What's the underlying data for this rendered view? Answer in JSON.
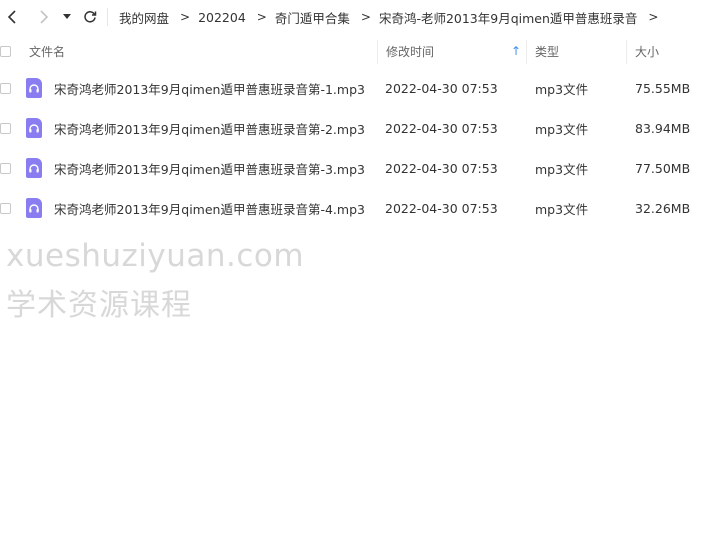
{
  "toolbar": {
    "breadcrumbs": [
      "我的网盘",
      "202204",
      "奇门遁甲合集",
      "宋奇鸿-老师2013年9月qimen遁甲普惠班录音"
    ],
    "separator": ">"
  },
  "table": {
    "columns": {
      "name": "文件名",
      "modified": "修改时间",
      "type": "类型",
      "size": "大小"
    },
    "sort_indicator": "↑",
    "rows": [
      {
        "name": "宋奇鸿老师2013年9月qimen遁甲普惠班录音第-1.mp3",
        "modified": "2022-04-30 07:53",
        "type": "mp3文件",
        "size": "75.55MB"
      },
      {
        "name": "宋奇鸿老师2013年9月qimen遁甲普惠班录音第-2.mp3",
        "modified": "2022-04-30 07:53",
        "type": "mp3文件",
        "size": "83.94MB"
      },
      {
        "name": "宋奇鸿老师2013年9月qimen遁甲普惠班录音第-3.mp3",
        "modified": "2022-04-30 07:53",
        "type": "mp3文件",
        "size": "77.50MB"
      },
      {
        "name": "宋奇鸿老师2013年9月qimen遁甲普惠班录音第-4.mp3",
        "modified": "2022-04-30 07:53",
        "type": "mp3文件",
        "size": "32.26MB"
      }
    ]
  },
  "watermark": {
    "line1": "xueshuziyuan.com",
    "line2": "学术资源课程"
  },
  "colors": {
    "accent": "#3d8ff2",
    "file_icon": "#8a7df2",
    "watermark": "#d8d8d8"
  },
  "icons": {
    "back": "chevron-left-icon",
    "forward": "chevron-right-icon",
    "dropdown": "caret-down-icon",
    "refresh": "refresh-icon",
    "file": "audio-file-icon"
  }
}
